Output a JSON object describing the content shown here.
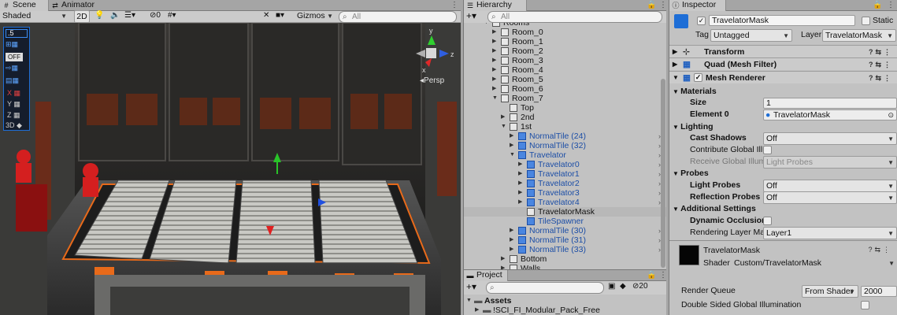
{
  "scene": {
    "tabs": [
      {
        "label": "Scene",
        "icon": "#"
      },
      {
        "label": "Animator",
        "icon": "⇄"
      }
    ],
    "toolbar": {
      "shading": "Shaded",
      "mode_2d": "2D",
      "fx_count": "0",
      "gizmos": "Gizmos",
      "search_placeholder": "All"
    },
    "gizmo_label": "Persp",
    "overlay": {
      "snap_value": ".5",
      "off_label": "OFF",
      "axes": [
        "X",
        "Y",
        "Z"
      ],
      "mode_3d": "3D"
    }
  },
  "hierarchy": {
    "title": "Hierarchy",
    "search_placeholder": "All",
    "items": [
      {
        "label": "Rooms",
        "indent": 0,
        "fold": "▼",
        "color": "black"
      },
      {
        "label": "Room_0",
        "indent": 1,
        "fold": "▶",
        "color": "black"
      },
      {
        "label": "Room_1",
        "indent": 1,
        "fold": "▶",
        "color": "black"
      },
      {
        "label": "Room_2",
        "indent": 1,
        "fold": "▶",
        "color": "black"
      },
      {
        "label": "Room_3",
        "indent": 1,
        "fold": "▶",
        "color": "black"
      },
      {
        "label": "Room_4",
        "indent": 1,
        "fold": "▶",
        "color": "black"
      },
      {
        "label": "Room_5",
        "indent": 1,
        "fold": "▶",
        "color": "black"
      },
      {
        "label": "Room_6",
        "indent": 1,
        "fold": "▶",
        "color": "black"
      },
      {
        "label": "Room_7",
        "indent": 1,
        "fold": "▼",
        "color": "black"
      },
      {
        "label": "Top",
        "indent": 2,
        "fold": "",
        "color": "black"
      },
      {
        "label": "2nd",
        "indent": 2,
        "fold": "▶",
        "color": "black"
      },
      {
        "label": "1st",
        "indent": 2,
        "fold": "▼",
        "color": "black"
      },
      {
        "label": "NormalTile (24)",
        "indent": 3,
        "fold": "▶",
        "color": "blue",
        "more": true
      },
      {
        "label": "NormalTile (32)",
        "indent": 3,
        "fold": "▶",
        "color": "blue",
        "more": true
      },
      {
        "label": "Travelator",
        "indent": 3,
        "fold": "▼",
        "color": "blue",
        "more": true
      },
      {
        "label": "Travelator0",
        "indent": 4,
        "fold": "▶",
        "color": "blue",
        "more": true
      },
      {
        "label": "Travelator1",
        "indent": 4,
        "fold": "▶",
        "color": "blue",
        "more": true
      },
      {
        "label": "Travelator2",
        "indent": 4,
        "fold": "▶",
        "color": "blue",
        "more": true
      },
      {
        "label": "Travelator3",
        "indent": 4,
        "fold": "▶",
        "color": "blue",
        "more": true
      },
      {
        "label": "Travelator4",
        "indent": 4,
        "fold": "▶",
        "color": "blue",
        "more": true
      },
      {
        "label": "TravelatorMask",
        "indent": 4,
        "fold": "",
        "color": "black",
        "selected": true
      },
      {
        "label": "TileSpawner",
        "indent": 4,
        "fold": "",
        "color": "blue"
      },
      {
        "label": "NormalTile (30)",
        "indent": 3,
        "fold": "▶",
        "color": "blue",
        "more": true
      },
      {
        "label": "NormalTile (31)",
        "indent": 3,
        "fold": "▶",
        "color": "blue",
        "more": true
      },
      {
        "label": "NormalTile (33)",
        "indent": 3,
        "fold": "▶",
        "color": "blue",
        "more": true
      },
      {
        "label": "Bottom",
        "indent": 2,
        "fold": "▶",
        "color": "black"
      },
      {
        "label": "Walls",
        "indent": 2,
        "fold": "▶",
        "color": "black"
      }
    ]
  },
  "project": {
    "title": "Project",
    "hidden_count": "20",
    "folders": [
      {
        "label": "Assets",
        "fold": "▼"
      },
      {
        "label": "!SCI_FI_Modular_Pack_Free",
        "fold": "▶"
      }
    ]
  },
  "inspector": {
    "title": "Inspector",
    "object_name": "TravelatorMask",
    "static_label": "Static",
    "tag_label": "Tag",
    "tag_value": "Untagged",
    "layer_label": "Layer",
    "layer_value": "TravelatorMask",
    "components": [
      "Transform",
      "Quad (Mesh Filter)",
      "Mesh Renderer"
    ],
    "materials_section": "Materials",
    "size_label": "Size",
    "size_value": "1",
    "element_label": "Element 0",
    "element_value": "TravelatorMask",
    "lighting_section": "Lighting",
    "cast_shadows_label": "Cast Shadows",
    "cast_shadows_value": "Off",
    "contribute_gi_label": "Contribute Global Illu",
    "receive_gi_label": "Receive Global Illumi",
    "receive_gi_value": "Light Probes",
    "probes_section": "Probes",
    "light_probes_label": "Light Probes",
    "light_probes_value": "Off",
    "reflection_probes_label": "Reflection Probes",
    "reflection_probes_value": "Off",
    "additional_section": "Additional Settings",
    "dynamic_occlusion_label": "Dynamic Occlusion",
    "rendering_layer_label": "Rendering Layer Mas",
    "rendering_layer_value": "Layer1",
    "material_name": "TravelatorMask",
    "shader_label": "Shader",
    "shader_value": "Custom/TravelatorMask",
    "render_queue_label": "Render Queue",
    "render_queue_source": "From Shader",
    "render_queue_value": "2000",
    "double_sided_gi_label": "Double Sided Global Illumination"
  },
  "colors": {
    "selection": "#9bb6da",
    "prefab_blue": "#1c4ea6",
    "panel": "#c2c2c2"
  }
}
